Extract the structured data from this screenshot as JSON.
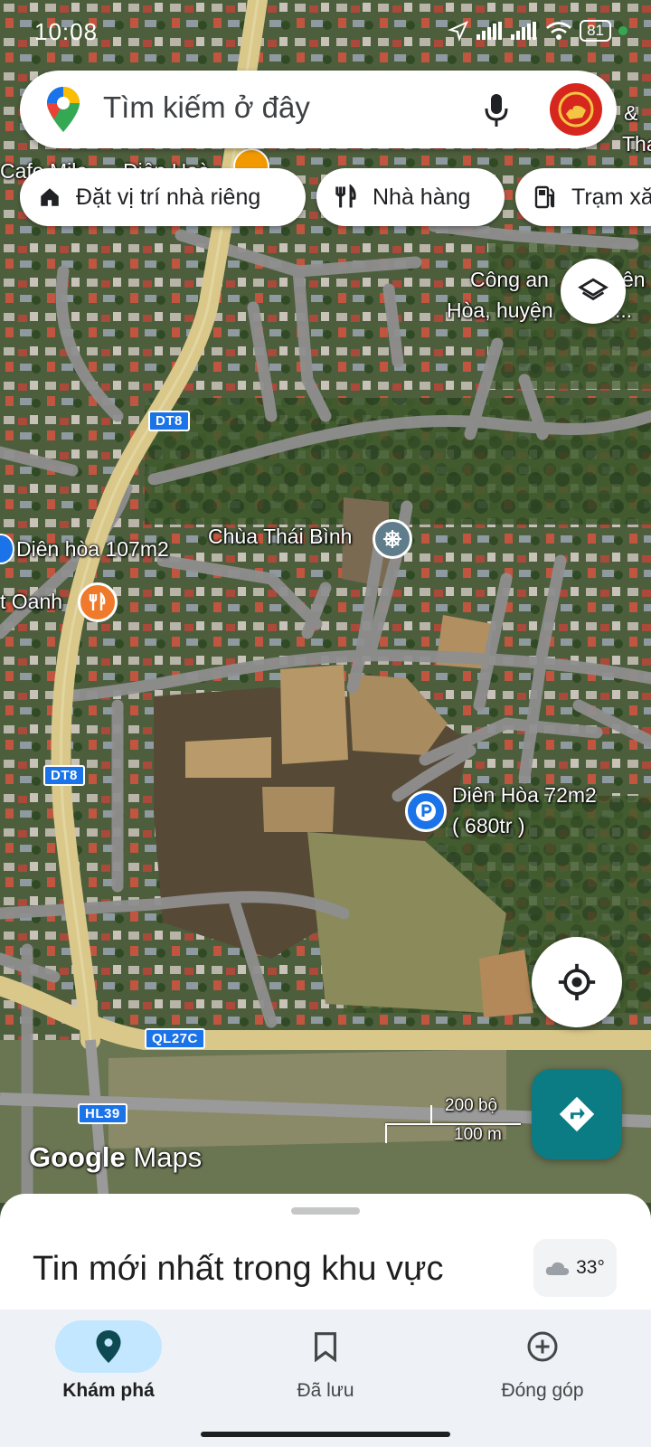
{
  "status": {
    "time": "10:08",
    "battery": "81"
  },
  "search": {
    "placeholder": "Tìm kiếm ở đây"
  },
  "chips": [
    {
      "label": "Đặt vị trí nhà riêng",
      "icon": "home-icon"
    },
    {
      "label": "Nhà hàng",
      "icon": "restaurant-icon"
    },
    {
      "label": "Trạm xă",
      "icon": "gas-station-icon"
    }
  ],
  "map": {
    "labels": {
      "cafe": "Cafe Mila",
      "dien_hoa_top": "Diên Hoà",
      "ampersand": "&",
      "tha": "Tha",
      "cong_an_1": "Công an",
      "cong_an_1b": "ên",
      "cong_an_2": "Hòa, huyện",
      "cong_an_2b": "...",
      "chua": "Chùa Thái Bình",
      "dien_hoa_107": "Diên hòa 107m2",
      "oanh": "t Oanh",
      "dien_hoa_72_line1": "Diên Hòa 72m2",
      "dien_hoa_72_line2": "( 680tr )"
    },
    "roads": [
      "DT8",
      "DT8",
      "QL27C",
      "HL39"
    ],
    "scale": {
      "feet": "200 bộ",
      "meters": "100 m"
    },
    "logo": {
      "google": "Google",
      "maps": "Maps"
    }
  },
  "sheet": {
    "title": "Tin mới nhất trong khu vực",
    "temperature": "33°"
  },
  "nav": [
    {
      "label": "Khám phá",
      "icon": "explore-pin-icon",
      "active": true
    },
    {
      "label": "Đã lưu",
      "icon": "bookmark-icon",
      "active": false
    },
    {
      "label": "Đóng góp",
      "icon": "add-circle-icon",
      "active": false
    }
  ],
  "colors": {
    "accent": "#0b7b84",
    "road_major": "#d9c88a",
    "nav_active_pill": "#c2e7ff"
  }
}
